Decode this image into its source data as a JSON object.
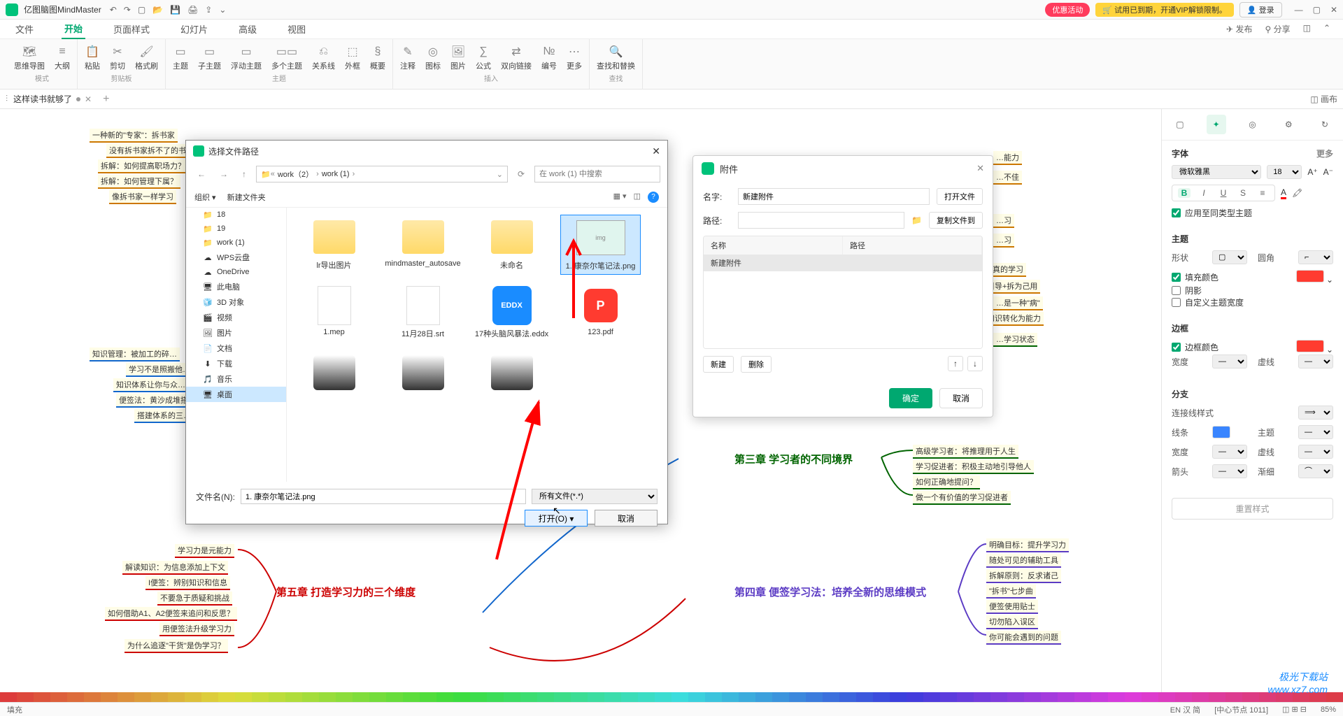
{
  "app": {
    "title": "亿图脑图MindMaster"
  },
  "titlebar": {
    "promo_badge": "优惠活动",
    "vip_badge": "🛒 试用已到期，开通VIP解锁限制。",
    "login_badge": "👤 登录"
  },
  "menubar": {
    "items": [
      "文件",
      "开始",
      "页面样式",
      "幻灯片",
      "高级",
      "视图"
    ],
    "active": 1,
    "right": {
      "publish": "发布",
      "share": "分享"
    }
  },
  "ribbon": {
    "groups": [
      {
        "label": "模式",
        "tools": [
          {
            "icon": "🗺",
            "text": "思维导图"
          },
          {
            "icon": "≡",
            "text": "大纲"
          }
        ]
      },
      {
        "label": "剪贴板",
        "tools": [
          {
            "icon": "📋",
            "text": "粘贴"
          },
          {
            "icon": "✂",
            "text": "剪切"
          },
          {
            "icon": "🖌",
            "text": "格式刷"
          }
        ]
      },
      {
        "label": "主题",
        "tools": [
          {
            "icon": "▭",
            "text": "主题"
          },
          {
            "icon": "▭",
            "text": "子主题"
          },
          {
            "icon": "▭",
            "text": "浮动主题"
          },
          {
            "icon": "▭▭",
            "text": "多个主题"
          },
          {
            "icon": "⎌",
            "text": "关系线"
          },
          {
            "icon": "⬚",
            "text": "外框"
          },
          {
            "icon": "§",
            "text": "概要"
          }
        ]
      },
      {
        "label": "插入",
        "tools": [
          {
            "icon": "✎",
            "text": "注释"
          },
          {
            "icon": "◎",
            "text": "图标"
          },
          {
            "icon": "🖼",
            "text": "图片"
          },
          {
            "icon": "∑",
            "text": "公式"
          },
          {
            "icon": "⇄",
            "text": "双向链接"
          },
          {
            "icon": "№",
            "text": "编号"
          },
          {
            "icon": "⋯",
            "text": "更多"
          }
        ]
      },
      {
        "label": "查找",
        "tools": [
          {
            "icon": "🔍",
            "text": "查找和替换"
          }
        ]
      }
    ]
  },
  "tabs": {
    "active": "这样读书就够了",
    "right_label": "画布"
  },
  "right_panel": {
    "font_section": "字体",
    "more": "更多",
    "font_family": "微软雅黑",
    "font_size": "18",
    "apply_all": "应用至同类型主题",
    "topic_section": "主题",
    "shape_label": "形状",
    "corner_label": "圆角",
    "fill_label": "填充颜色",
    "shadow_label": "阴影",
    "custom_width_label": "自定义主题宽度",
    "border_section": "边框",
    "border_color_label": "边框颜色",
    "width_label": "宽度",
    "dash_label": "虚线",
    "branch_section": "分支",
    "line_style_label": "连接线样式",
    "line_color_label": "线条",
    "topic2_label": "主题",
    "arrow_label": "箭头",
    "gradient_label": "渐细",
    "reset_btn": "重置样式",
    "fill_color": "#ff3b30",
    "border_color": "#ff3b30",
    "line_color": "#3985ff"
  },
  "file_dialog": {
    "title": "选择文件路径",
    "breadcrumb": [
      "work（2）",
      "work (1)"
    ],
    "search_placeholder": "在 work (1) 中搜索",
    "organize": "组织",
    "new_folder": "新建文件夹",
    "tree": [
      {
        "icon": "📁",
        "label": "18"
      },
      {
        "icon": "📁",
        "label": "19"
      },
      {
        "icon": "📁",
        "label": "work (1)"
      },
      {
        "icon": "☁",
        "label": "WPS云盘"
      },
      {
        "icon": "☁",
        "label": "OneDrive"
      },
      {
        "icon": "🖥",
        "label": "此电脑"
      },
      {
        "icon": "🧊",
        "label": "3D 对象"
      },
      {
        "icon": "🎬",
        "label": "视频"
      },
      {
        "icon": "🖼",
        "label": "图片"
      },
      {
        "icon": "📄",
        "label": "文档"
      },
      {
        "icon": "⬇",
        "label": "下载"
      },
      {
        "icon": "🎵",
        "label": "音乐"
      },
      {
        "icon": "🖥",
        "label": "桌面",
        "selected": true
      }
    ],
    "files": [
      {
        "type": "folder",
        "label": "lr导出图片"
      },
      {
        "type": "folder",
        "label": "mindmaster_autosave"
      },
      {
        "type": "folder",
        "label": "未命名"
      },
      {
        "type": "image",
        "label": "1. 康奈尔笔记法.png",
        "selected": true
      },
      {
        "type": "file",
        "label": "1.mep"
      },
      {
        "type": "file",
        "label": "11月28日.srt"
      },
      {
        "type": "eddx",
        "label": "17种头脑风暴法.eddx"
      },
      {
        "type": "pdf",
        "label": "123.pdf"
      }
    ],
    "filename_label": "文件名(N):",
    "filename_value": "1. 康奈尔笔记法.png",
    "filter": "所有文件(*.*)",
    "open_btn": "打开(O)",
    "cancel_btn": "取消"
  },
  "attach_dialog": {
    "title": "附件",
    "name_label": "名字:",
    "name_value": "新建附件",
    "open_file_btn": "打开文件",
    "path_label": "路径:",
    "copy_btn": "复制文件到",
    "th_name": "名称",
    "th_path": "路径",
    "row_name": "新建附件",
    "new_btn": "新建",
    "delete_btn": "删除",
    "ok_btn": "确定",
    "cancel_btn": "取消"
  },
  "mindmap": {
    "ch5_title": "第五章 打造学习力的三个维度",
    "ch4_title": "第四章 便签学习法：培养全新的思维模式",
    "ch3_title": "第三章 学习者的不同境界",
    "ch5_nodes": [
      "学习力是元能力",
      "解读知识：为信息添加上下文",
      "I便签：辨别知识和信息",
      "不要急于质疑和挑战",
      "如何借助A1、A2便签来追问和反思？",
      "用便签法升级学习力",
      "为什么追逐\"干货\"是伪学习？"
    ],
    "ch4_nodes": [
      "明确目标：提升学习力",
      "随处可见的辅助工具",
      "拆解原则：反求诸己",
      "\"拆书\"七步曲",
      "便签使用贴士",
      "切勿陷入误区",
      "你可能会遇到的问题"
    ],
    "ch3_nodes": [
      "高级学习者：将推理用于人生",
      "学习促进者：积极主动地引导他人",
      "如何正确地提问？",
      "做一个有价值的学习促进者"
    ],
    "left_nodes": [
      "一种新的\"专家\"：拆书家",
      "没有拆书家拆不了的书",
      "拆解：如何提高职场力？",
      "拆解：如何管理下属？",
      "像拆书家一样学习",
      "知识管理：被加工的碎…",
      "学习不是照搬他…",
      "知识体系让你与众…",
      "便签法：黄沙成堆搭…",
      "搭建体系的三…"
    ],
    "right_col_nodes": [
      "…能力",
      "…不佳",
      "…习",
      "…习",
      "…真的学习",
      "…样引导+拆为己用",
      "…是一种\"病\"",
      "…知识转化为能力",
      "…学习状态"
    ]
  },
  "statusbar": {
    "left": "填充",
    "center": "[中心节点 1011]",
    "zoom": "85%",
    "lang": "EN 汉 简"
  },
  "watermark": "极光下载站\nwww.xz7.com",
  "chart_data": null
}
